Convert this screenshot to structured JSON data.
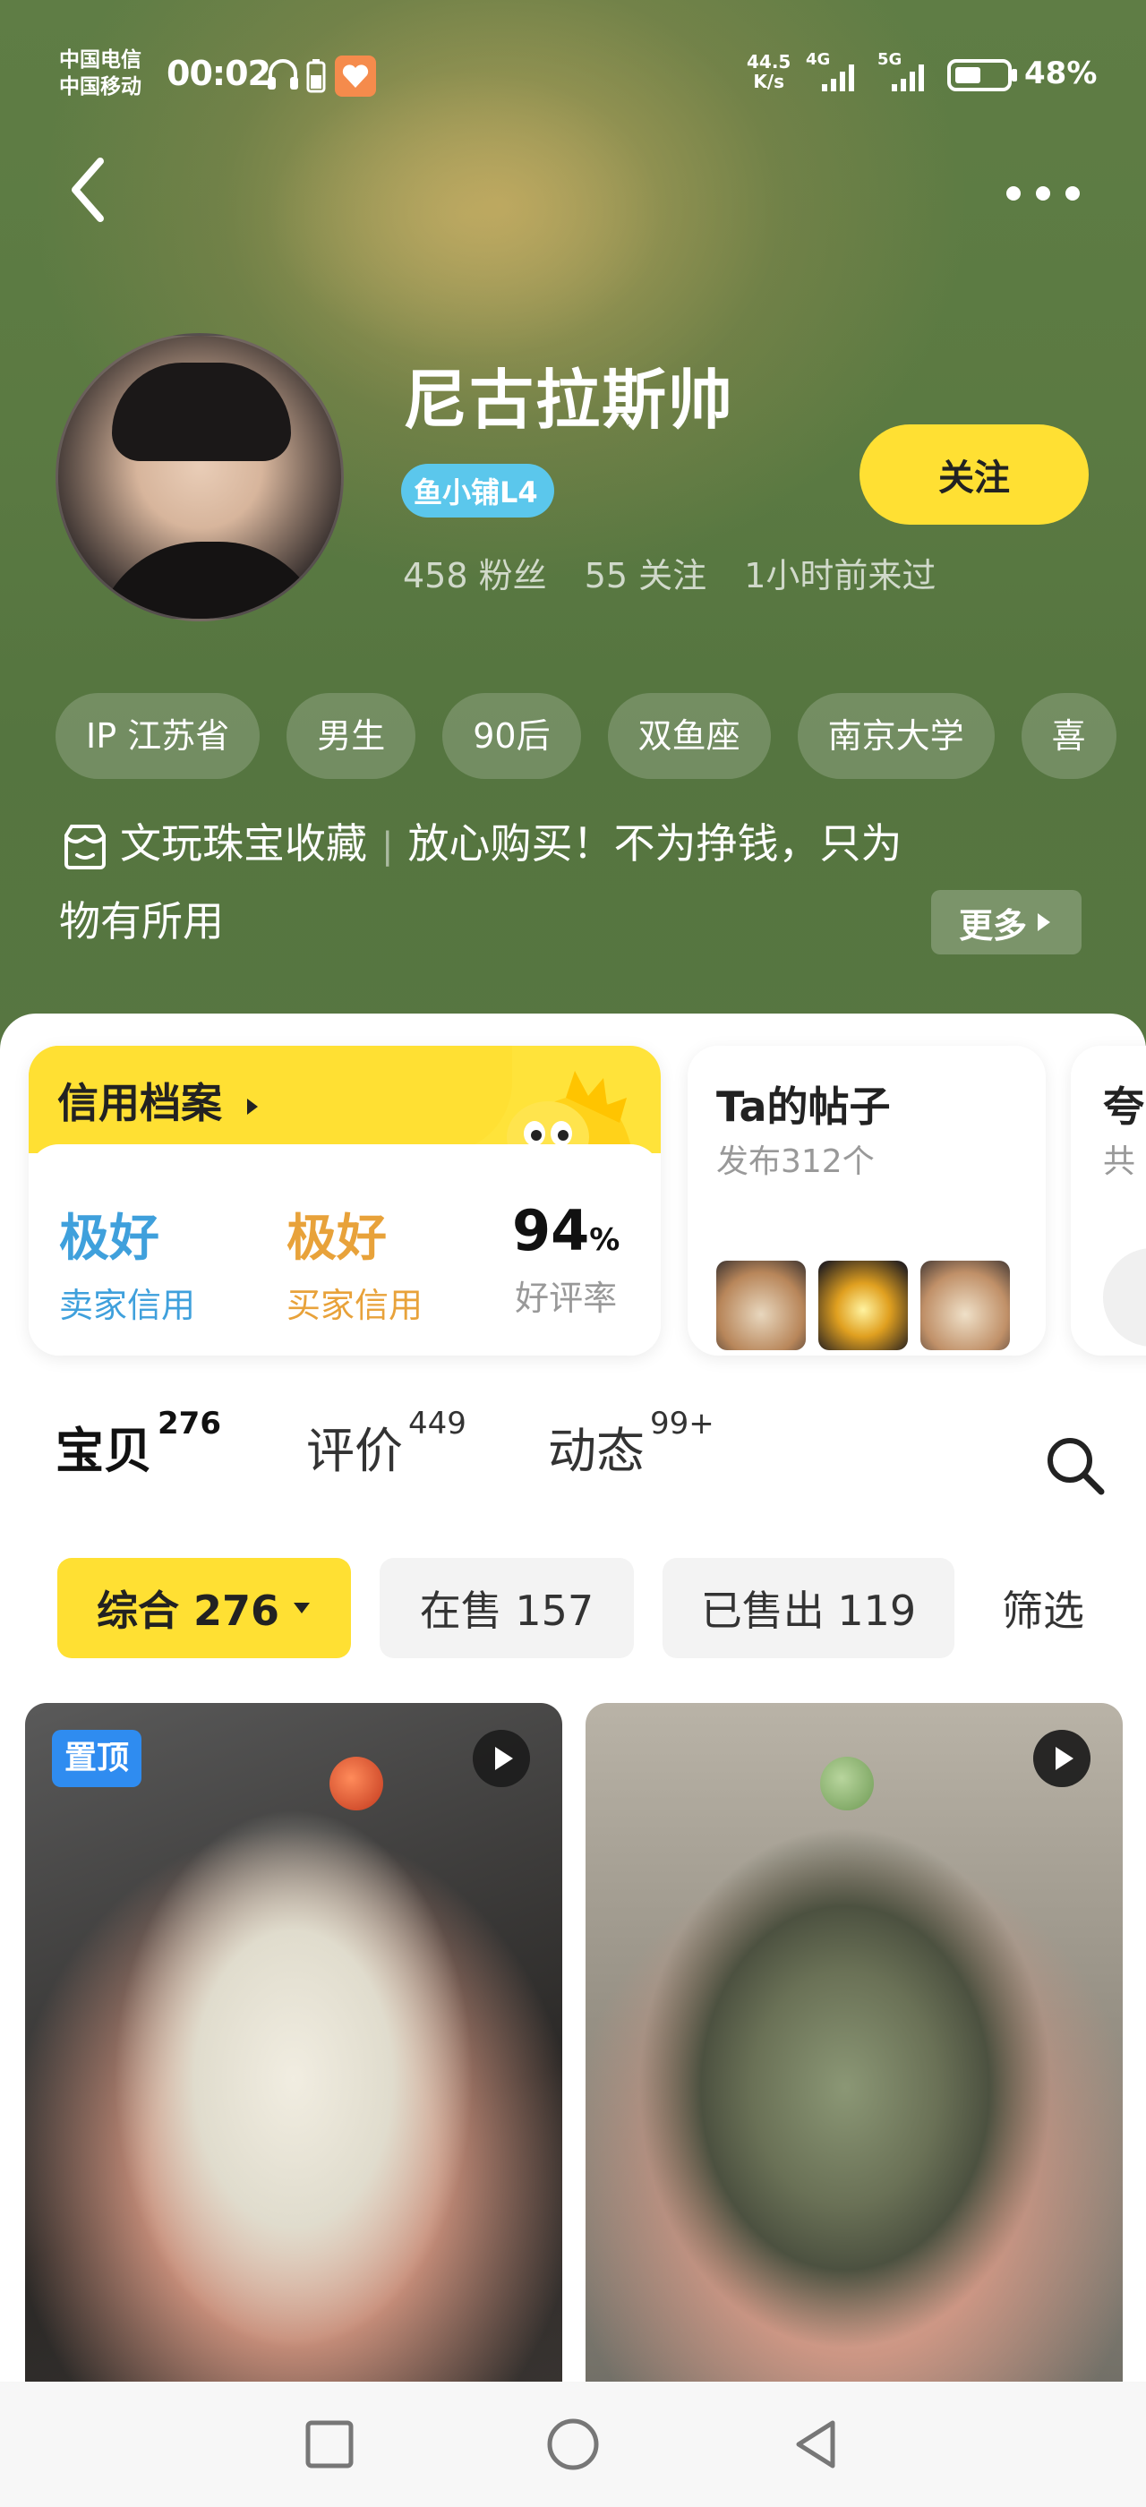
{
  "status_bar": {
    "carrier1": "中国电信",
    "carrier2": "中国移动",
    "time": "00:02",
    "net_speed_value": "44.5",
    "net_speed_unit": "K/s",
    "signal1": "4G",
    "signal2": "5G",
    "battery": "48%"
  },
  "profile": {
    "name": "尼古拉斯帅",
    "shop_badge": "鱼小铺L4",
    "followers": "458 粉丝",
    "following": "55 关注",
    "last_seen": "1小时前来过",
    "follow_label": "关注"
  },
  "tags": [
    "IP 江苏省",
    "男生",
    "90后",
    "双鱼座",
    "南京大学",
    "喜"
  ],
  "bio": {
    "category": "文玩珠宝收藏",
    "text_line1": "放心购买！不为挣钱，只为",
    "text_line2": "物有所用",
    "more_label": "更多"
  },
  "credit": {
    "title": "信用档案",
    "seller_value": "极好",
    "seller_label": "卖家信用",
    "buyer_value": "极好",
    "buyer_label": "买家信用",
    "rating_value": "94",
    "rating_unit": "%",
    "rating_label": "好评率"
  },
  "posts": {
    "title": "Ta的帖子",
    "subtitle": "发布312个"
  },
  "praise": {
    "title": "夸",
    "subtitle": "共"
  },
  "tabs": [
    {
      "label": "宝贝",
      "count": "276"
    },
    {
      "label": "评价",
      "count": "449"
    },
    {
      "label": "动态",
      "count": "99+"
    }
  ],
  "filters": {
    "all_label": "综合 276",
    "on_sale_label": "在售 157",
    "sold_label": "已售出 119",
    "filter_label": "筛选"
  },
  "products": [
    {
      "badge": "置顶"
    },
    {
      "badge": ""
    }
  ],
  "colors": {
    "accent_yellow": "#ffe033",
    "badge_blue": "#5bc7ec",
    "pin_blue": "#2f8cf0",
    "seller_blue": "#3fa0dc",
    "buyer_orange": "#e8a23a"
  }
}
